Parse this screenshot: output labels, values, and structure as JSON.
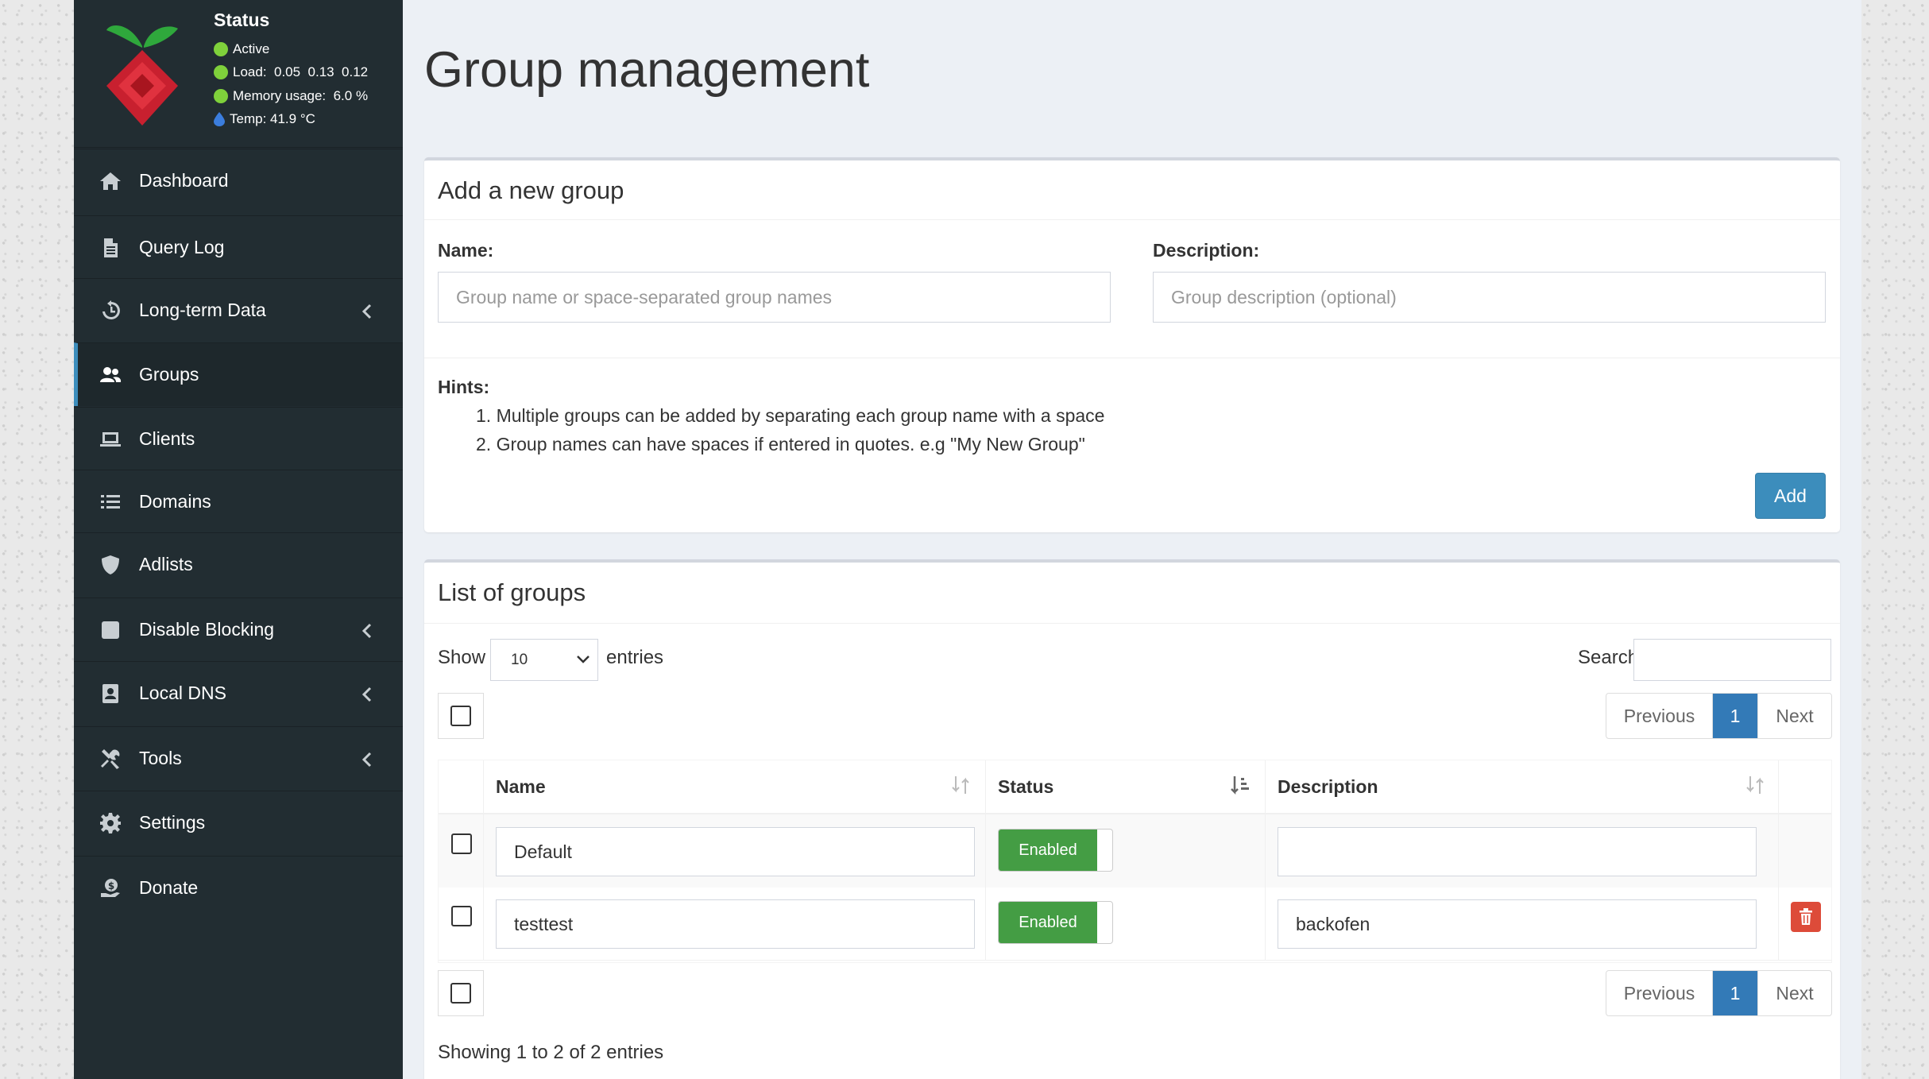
{
  "status": {
    "title": "Status",
    "active": "Active",
    "load": "Load:  0.05  0.13  0.12",
    "memory": "Memory usage:  6.0 %",
    "temp": "Temp: 41.9 °C"
  },
  "colors": {
    "sidebar_bg": "#222d32",
    "accent": "#3c8dbc",
    "enabled_green": "#449d44",
    "danger": "#dd4b39",
    "status_green": "#7fd13b"
  },
  "nav": [
    {
      "label": "Dashboard",
      "icon": "home-icon"
    },
    {
      "label": "Query Log",
      "icon": "file-icon"
    },
    {
      "label": "Long-term Data",
      "icon": "history-icon"
    },
    {
      "label": "Groups",
      "icon": "users-icon"
    },
    {
      "label": "Clients",
      "icon": "laptop-icon"
    },
    {
      "label": "Domains",
      "icon": "list-icon"
    },
    {
      "label": "Adlists",
      "icon": "shield-icon"
    },
    {
      "label": "Disable Blocking",
      "icon": "stop-icon"
    },
    {
      "label": "Local DNS",
      "icon": "address-book-icon"
    },
    {
      "label": "Tools",
      "icon": "tools-icon"
    },
    {
      "label": "Settings",
      "icon": "gear-icon"
    },
    {
      "label": "Donate",
      "icon": "donate-icon"
    }
  ],
  "page": {
    "title": "Group management"
  },
  "add_group": {
    "title": "Add a new group",
    "name_label": "Name:",
    "name_placeholder": "Group name or space-separated group names",
    "desc_label": "Description:",
    "desc_placeholder": "Group description (optional)",
    "hints_label": "Hints:",
    "hint1": "1. Multiple groups can be added by separating each group name with a space",
    "hint2": "2. Group names can have spaces if entered in quotes. e.g \"My New Group\"",
    "add_button": "Add"
  },
  "list": {
    "title": "List of groups",
    "show_label": "Show",
    "entries_value": "10",
    "entries_label": "entries",
    "search_label": "Search:",
    "previous": "Previous",
    "page": "1",
    "next": "Next",
    "col_name": "Name",
    "col_status": "Status",
    "col_description": "Description",
    "rows": [
      {
        "name": "Default",
        "status": "Enabled",
        "description": ""
      },
      {
        "name": "testtest",
        "status": "Enabled",
        "description": "backofen"
      }
    ],
    "showing": "Showing 1 to 2 of 2 entries"
  }
}
